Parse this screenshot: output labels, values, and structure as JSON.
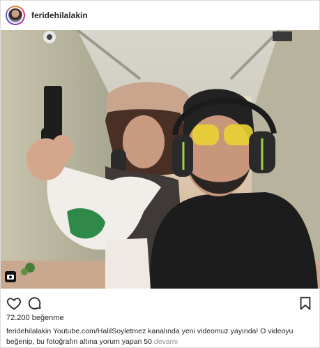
{
  "post": {
    "username": "feridehilalakin",
    "likes": "72.200 beğenme",
    "caption_user": "feridehilalakin",
    "caption_text": "Youtube.com/HalilSoyletmez kanalında yeni videomuz yayında! O videoyu beğenip, bu fotoğrafın altına yorum yapan 50",
    "more_label": "devamı"
  },
  "icons": {
    "like": "heart-outline-icon",
    "comment": "comment-bubble-icon",
    "save": "bookmark-outline-icon",
    "carousel": "camera-badge-icon"
  },
  "colors": {
    "text": "#262626",
    "muted": "#8e8e8e",
    "border": "#dbdbdb"
  }
}
